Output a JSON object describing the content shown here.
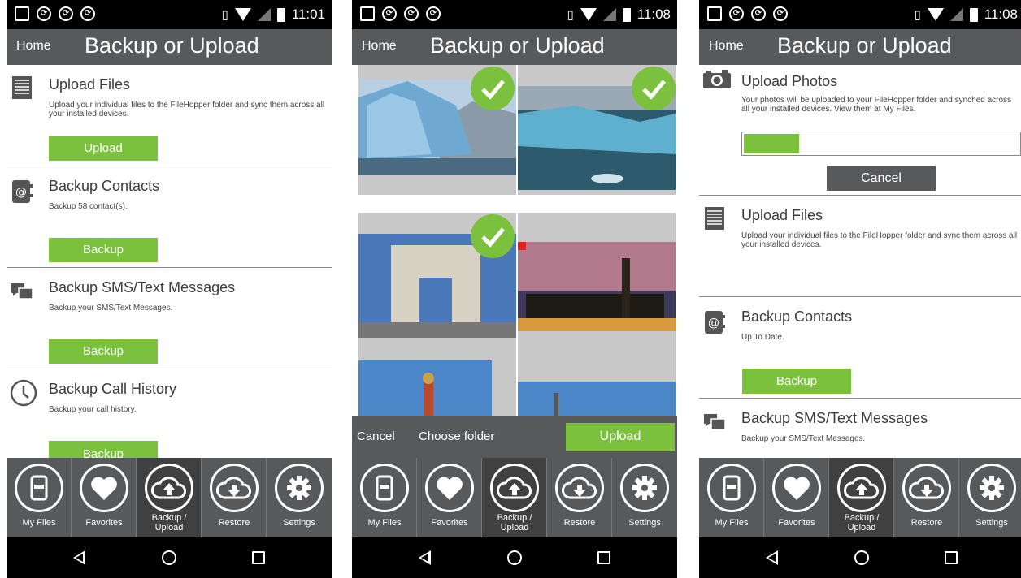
{
  "screens": [
    {
      "time": "11:01",
      "app_bar": {
        "home": "Home",
        "title": "Backup or Upload"
      },
      "sections": [
        {
          "title": "Upload Files",
          "desc": "Upload your individual files to the FileHopper folder and sync them across all your installed devices.",
          "button": "Upload"
        },
        {
          "title": "Backup Contacts",
          "desc": "Backup 58 contact(s).",
          "button": "Backup"
        },
        {
          "title": "Backup SMS/Text Messages",
          "desc": "Backup your SMS/Text Messages.",
          "button": "Backup"
        },
        {
          "title": "Backup Call History",
          "desc": "Backup your call history.",
          "button": "Backup"
        }
      ]
    },
    {
      "time": "11:08",
      "app_bar": {
        "home": "Home",
        "title": "Backup or Upload"
      },
      "action_bar": {
        "cancel": "Cancel",
        "choose_folder": "Choose folder",
        "upload": "Upload"
      }
    },
    {
      "time": "11:08",
      "app_bar": {
        "home": "Home",
        "title": "Backup or Upload"
      },
      "upload_photos": {
        "title": "Upload Photos",
        "desc": "Your photos will be uploaded to your FileHopper folder and synched across all your installed devices. View them at My Files.",
        "progress": 0.2,
        "cancel": "Cancel"
      },
      "sections": [
        {
          "title": "Upload Files",
          "desc": "Upload your individual files to the FileHopper folder and sync them across all your installed devices."
        },
        {
          "title": "Backup Contacts",
          "desc": "Up To Date.",
          "button": "Backup"
        },
        {
          "title": "Backup SMS/Text Messages",
          "desc": "Backup your SMS/Text Messages."
        }
      ]
    }
  ],
  "nav": {
    "my_files": "My Files",
    "favorites": "Favorites",
    "backup_upload": "Backup / Upload",
    "restore": "Restore",
    "settings": "Settings"
  },
  "colors": {
    "accent_green": "#7cc13e",
    "bar_gray": "#58595b",
    "active_nav": "#404041"
  },
  "icons": {
    "upload_files": "document-lines-icon",
    "contacts": "address-book-icon",
    "sms": "chat-bubbles-icon",
    "call_history": "clock-icon",
    "upload_photos": "camera-icon",
    "checked": "checkmark-icon",
    "my_files": "phone-icon",
    "favorites": "heart-icon",
    "backup_upload": "cloud-upload-icon",
    "restore": "cloud-download-icon",
    "settings": "gear-icon"
  }
}
